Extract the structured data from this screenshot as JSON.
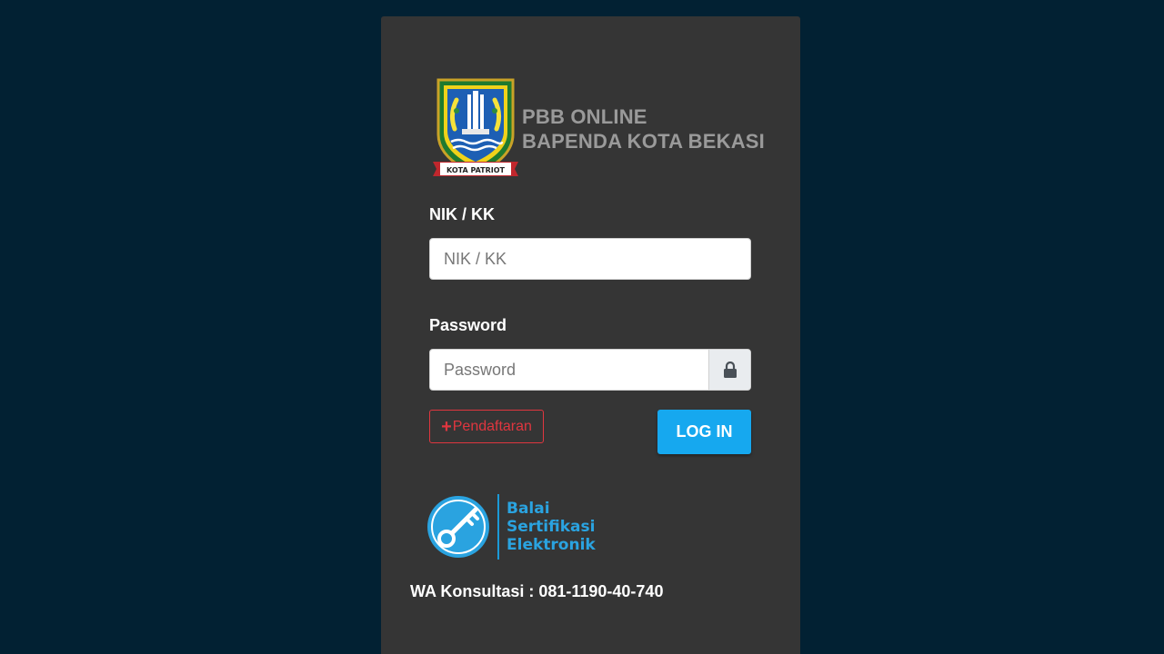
{
  "brand": {
    "line1": "PBB ONLINE",
    "line2": "BAPENDA KOTA BEKASI",
    "crest_icon": "kota-bekasi-crest",
    "crest_ribbon_text": "KOTA PATRIOT"
  },
  "form": {
    "nik_label": "NIK / KK",
    "nik_placeholder": "NIK / KK",
    "password_label": "Password",
    "password_placeholder": "Password",
    "password_icon": "lock-icon"
  },
  "actions": {
    "register_label": "Pendaftaran",
    "register_icon": "plus-icon",
    "login_label": "LOG IN"
  },
  "certification": {
    "line1": "Balai",
    "line2": "Sertifikasi",
    "line3": "Elektronik",
    "logo_icon": "key-icon"
  },
  "contact": {
    "text": "WA Konsultasi : 081-1190-40-740"
  },
  "colors": {
    "background": "#022133",
    "panel": "#353535",
    "accent": "#16a8ef",
    "danger": "#e0363f",
    "bsre": "#2aa3e0"
  }
}
